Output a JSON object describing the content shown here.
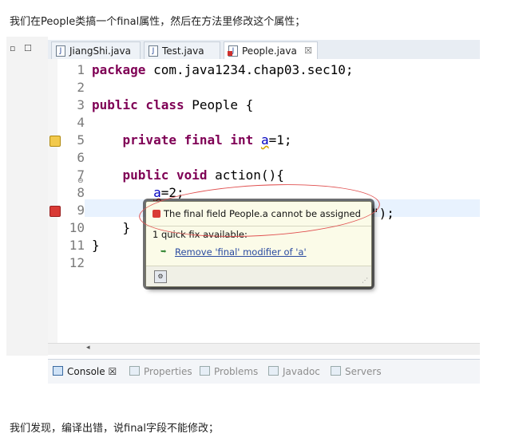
{
  "captions": {
    "top": "我们在People类搞一个final属性，然后在方法里修改这个属性；",
    "bottom": "我们发现，编译出错，说final字段不能修改；"
  },
  "editor_tabs": [
    {
      "label": "JiangShi.java",
      "active": false,
      "close": ""
    },
    {
      "label": "Test.java",
      "active": false,
      "close": ""
    },
    {
      "label": "People.java",
      "active": true,
      "close": "☒"
    }
  ],
  "code": {
    "line_numbers": [
      "1",
      "2",
      "3",
      "4",
      "5",
      "6",
      "7",
      "8",
      "9",
      "10",
      "11",
      "12"
    ],
    "l1_kw": "package",
    "l1_rest": " com.java1234.chap03.sec10;",
    "l3_kw": "public class",
    "l3_rest": " People {",
    "l5_indent": "    ",
    "l5_kw": "private final int",
    "l5_sp": " ",
    "l5_var": "a",
    "l5_rest": "=1;",
    "l7_indent": "    ",
    "l7_kw": "public void",
    "l7_rest": " action(){",
    "l8_indent": "        ",
    "l8_var": "a",
    "l8_rest": "=2;",
    "l9_visible": "公民！\");",
    "l10": "    }",
    "l11": "}"
  },
  "popup": {
    "title": "The final field People.a cannot be assigned",
    "count": "1 quick fix available:",
    "fix": "Remove 'final' modifier of 'a'"
  },
  "bottom_tabs": [
    {
      "label": "Console",
      "active": true,
      "close": "☒"
    },
    {
      "label": "Properties",
      "active": false,
      "close": ""
    },
    {
      "label": "Problems",
      "active": false,
      "close": ""
    },
    {
      "label": "Javadoc",
      "active": false,
      "close": ""
    },
    {
      "label": "Servers",
      "active": false,
      "close": ""
    }
  ],
  "icons": {
    "minimize": "minimize-icon",
    "maximize": "maximize-icon",
    "java_file": "java-file-icon",
    "error": "error-marker-icon",
    "warning": "warning-marker-icon",
    "quickfix": "quickfix-icon",
    "settings": "settings-icon"
  },
  "colors": {
    "keyword": "#7f0055",
    "field": "#0000c0",
    "line_highlight": "#e8f2fe",
    "popup_bg": "#fbfbe8",
    "annotation": "#e05050"
  }
}
